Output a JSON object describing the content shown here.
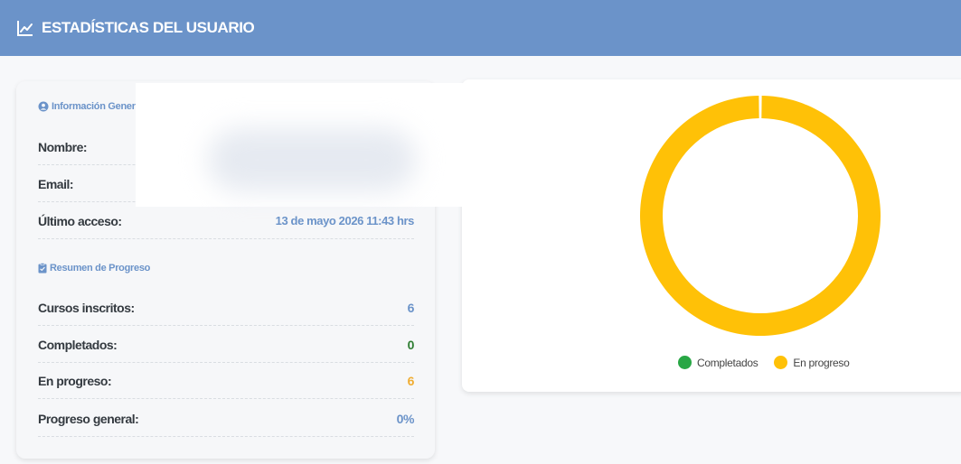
{
  "header": {
    "title": "ESTADÍSTICAS DEL USUARIO",
    "icon": "chart-line-icon"
  },
  "info": {
    "section_title": "Información General",
    "icon": "user-circle-icon",
    "name_label": "Nombre:",
    "email_label": "Email:",
    "last_access_label": "Último acceso:",
    "last_access_value": "13 de mayo 2026 11:43 hrs"
  },
  "progress": {
    "section_title": "Resumen de Progreso",
    "icon": "clipboard-check-icon",
    "rows": [
      {
        "label": "Cursos inscritos:",
        "value": "6",
        "color": "#6b93c9"
      },
      {
        "label": "Completados:",
        "value": "0",
        "color": "#2e7d32"
      },
      {
        "label": "En progreso:",
        "value": "6",
        "color": "#f0ad32"
      },
      {
        "label": "Progreso general:",
        "value": "0%",
        "color": "#6b93c9"
      }
    ]
  },
  "chart_data": {
    "type": "pie",
    "categories": [
      "Completados",
      "En progreso"
    ],
    "values": [
      0,
      6
    ],
    "colors": [
      "#28a745",
      "#ffc107"
    ],
    "legend": "bottom"
  }
}
